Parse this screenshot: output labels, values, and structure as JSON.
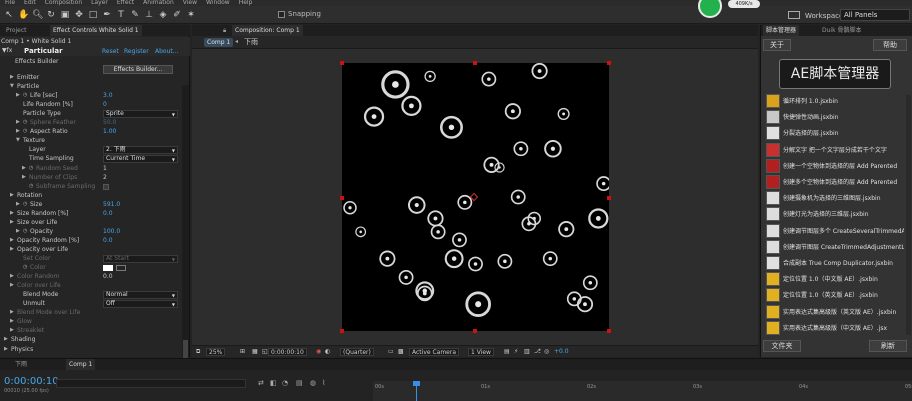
{
  "menubar": [
    "File",
    "Edit",
    "Composition",
    "Layer",
    "Effect",
    "Animation",
    "View",
    "Window",
    "Help"
  ],
  "toolbar": {
    "snapping_label": "Snapping",
    "speed_badge": "409K/s",
    "workspace_label": "Workspace:",
    "workspace_value": "All Panels"
  },
  "left_panel": {
    "tab_project": "Project",
    "tab_effect_controls": "Effect Controls White Solid 1",
    "comp_path": "Comp 1 • White Solid 1",
    "effect_name": "Particular",
    "reset": "Reset",
    "register": "Register",
    "about": "About...",
    "effects_builder_label": "Effects Builder",
    "effects_builder_button": "Effects Builder...",
    "rows": [
      {
        "indent": 1,
        "tri": "▶",
        "label": "Emitter"
      },
      {
        "indent": 1,
        "tri": "▼",
        "label": "Particle"
      },
      {
        "indent": 2,
        "tri": "▶",
        "sw": true,
        "label": "Life [sec]",
        "value": "3.0"
      },
      {
        "indent": 2,
        "label": "Life Random [%]",
        "value": "0"
      },
      {
        "indent": 2,
        "label": "Particle Type",
        "dropdown": "Sprite"
      },
      {
        "indent": 2,
        "tri": "▶",
        "sw": true,
        "label": "Sphere Feather",
        "value": "50.0",
        "dim": true
      },
      {
        "indent": 2,
        "tri": "▶",
        "sw": true,
        "label": "Aspect Ratio",
        "value": "1.00"
      },
      {
        "indent": 2,
        "tri": "▼",
        "label": "Texture"
      },
      {
        "indent": 3,
        "label": "Layer",
        "dropdown": "2. 下雨"
      },
      {
        "indent": 3,
        "label": "Time Sampling",
        "dropdown": "Current Time"
      },
      {
        "indent": 3,
        "tri": "▶",
        "sw": true,
        "label": "Random Seed",
        "value": "1",
        "dim": true,
        "white": true
      },
      {
        "indent": 3,
        "tri": "▶",
        "label": "Number of Clips",
        "value": "2",
        "dim": true,
        "white": true
      },
      {
        "indent": 3,
        "sw": true,
        "label": "Subframe Sampling",
        "dim": true,
        "check": true
      },
      {
        "indent": 1,
        "tri": "▶",
        "label": "Rotation"
      },
      {
        "indent": 2,
        "tri": "▶",
        "sw": true,
        "label": "Size",
        "value": "591.0"
      },
      {
        "indent": 1,
        "tri": "▶",
        "label": "Size Random [%]",
        "value": "0.0"
      },
      {
        "indent": 1,
        "tri": "▶",
        "label": "Size over Life"
      },
      {
        "indent": 2,
        "tri": "▶",
        "sw": true,
        "label": "Opacity",
        "value": "100.0"
      },
      {
        "indent": 1,
        "tri": "▶",
        "label": "Opacity Random [%]",
        "value": "0.0"
      },
      {
        "indent": 1,
        "tri": "▶",
        "label": "Opacity over Life"
      },
      {
        "indent": 2,
        "label": "Set Color",
        "dropdown": "At Start",
        "dim": true
      },
      {
        "indent": 2,
        "sw": true,
        "label": "Color",
        "dim": true,
        "swatch": true
      },
      {
        "indent": 1,
        "tri": "▶",
        "label": "Color Random",
        "value": "0.0",
        "dim": true,
        "white": true
      },
      {
        "indent": 1,
        "tri": "▶",
        "label": "Color over Life",
        "dim": true
      },
      {
        "indent": 2,
        "label": "Blend Mode",
        "dropdown": "Normal"
      },
      {
        "indent": 2,
        "label": "Unmult",
        "dropdown": "Off"
      },
      {
        "indent": 1,
        "tri": "▶",
        "label": "Blend Mode over Life",
        "dim": true
      },
      {
        "indent": 1,
        "tri": "▶",
        "label": "Glow",
        "dim": true
      },
      {
        "indent": 1,
        "tri": "▶",
        "label": "Streaklet",
        "dim": true
      },
      {
        "indent": 0,
        "tri": "▶",
        "label": "Shading"
      },
      {
        "indent": 0,
        "tri": "▶",
        "label": "Physics"
      }
    ]
  },
  "comp_panel": {
    "tab_label": "Composition: Comp 1",
    "sub_tab": "Comp 1",
    "layer_name": "下雨",
    "zoom": "25%",
    "timecode": "0:00:00:10",
    "resolution": "(Quarter)",
    "camera": "Active Camera",
    "views": "1 View",
    "exposure": "+0.0"
  },
  "right_panel": {
    "tab_script": "脚本管理器",
    "tab_duik": "Duik 骨骼脚本",
    "close_button": "关于",
    "help_button": "帮助",
    "banner": "AE脚本管理器",
    "file_button": "文件夹",
    "refresh_button": "刷新",
    "scripts": [
      "循环排列 1.0.jsxbin",
      "快捷弹性动画.jsxbin",
      "分裂选择的层.jsxbin",
      "分解文字 把一个文字层分成若干个文字",
      "创建一个空物体到选择的层 Add Parented",
      "创建多个空物体到选择的层 Add Parented",
      "创建摄象机为选择的三维图层.jsxbin",
      "创建灯光为选择的三维层.jsxbin",
      "创建调节图层多个 CreateSeveralTrimmedA",
      "创建调节图层 CreateTrimmedAdjustmentLa",
      "合成副本 True Comp Duplicator.jsxbin",
      "定位位置 1.0（中文版 AE）.jsxbin",
      "定位位置 1.0（英文版 AE）.jsxbin",
      "实用表达式集高级版（英文版 AE）.jsxbin",
      "实用表达式集高级版（中文版 AE）.jsx"
    ]
  },
  "timeline": {
    "tab_rain": "下雨",
    "tab_comp": "Comp 1",
    "time": "0:00:00:10",
    "fps": "00010 (25.00 fps)",
    "ruler": [
      "00s",
      "01s",
      "02s",
      "03s",
      "04s",
      "05s"
    ]
  },
  "particles": [
    [
      0.03,
      0.54,
      0.5
    ],
    [
      0.07,
      0.63,
      0.4
    ],
    [
      0.12,
      0.2,
      0.75
    ],
    [
      0.2,
      0.08,
      1.05
    ],
    [
      0.26,
      0.16,
      0.75
    ],
    [
      0.33,
      0.05,
      0.42
    ],
    [
      0.41,
      0.24,
      0.85
    ],
    [
      0.46,
      0.52,
      0.55
    ],
    [
      0.55,
      0.06,
      0.55
    ],
    [
      0.59,
      0.39,
      0.38
    ],
    [
      0.67,
      0.32,
      0.55
    ],
    [
      0.83,
      0.19,
      0.45
    ],
    [
      0.79,
      0.32,
      0.65
    ],
    [
      0.64,
      0.18,
      0.6
    ],
    [
      0.74,
      0.03,
      0.6
    ],
    [
      0.96,
      0.58,
      0.75
    ],
    [
      0.98,
      0.45,
      0.55
    ],
    [
      0.87,
      0.88,
      0.55
    ],
    [
      0.72,
      0.58,
      0.5
    ],
    [
      0.84,
      0.62,
      0.6
    ],
    [
      0.78,
      0.73,
      0.55
    ],
    [
      0.17,
      0.73,
      0.6
    ],
    [
      0.28,
      0.53,
      0.65
    ],
    [
      0.31,
      0.85,
      0.7
    ],
    [
      0.31,
      0.86,
      0.58
    ],
    [
      0.51,
      0.9,
      0.95
    ],
    [
      0.61,
      0.74,
      0.55
    ],
    [
      0.66,
      0.5,
      0.55
    ],
    [
      0.7,
      0.6,
      0.55
    ],
    [
      0.93,
      0.82,
      0.55
    ],
    [
      0.91,
      0.9,
      0.6
    ],
    [
      0.42,
      0.73,
      0.7
    ],
    [
      0.35,
      0.58,
      0.6
    ],
    [
      0.56,
      0.38,
      0.6
    ],
    [
      0.36,
      0.63,
      0.55
    ],
    [
      0.44,
      0.66,
      0.55
    ],
    [
      0.24,
      0.8,
      0.55
    ],
    [
      0.5,
      0.75,
      0.55
    ]
  ]
}
